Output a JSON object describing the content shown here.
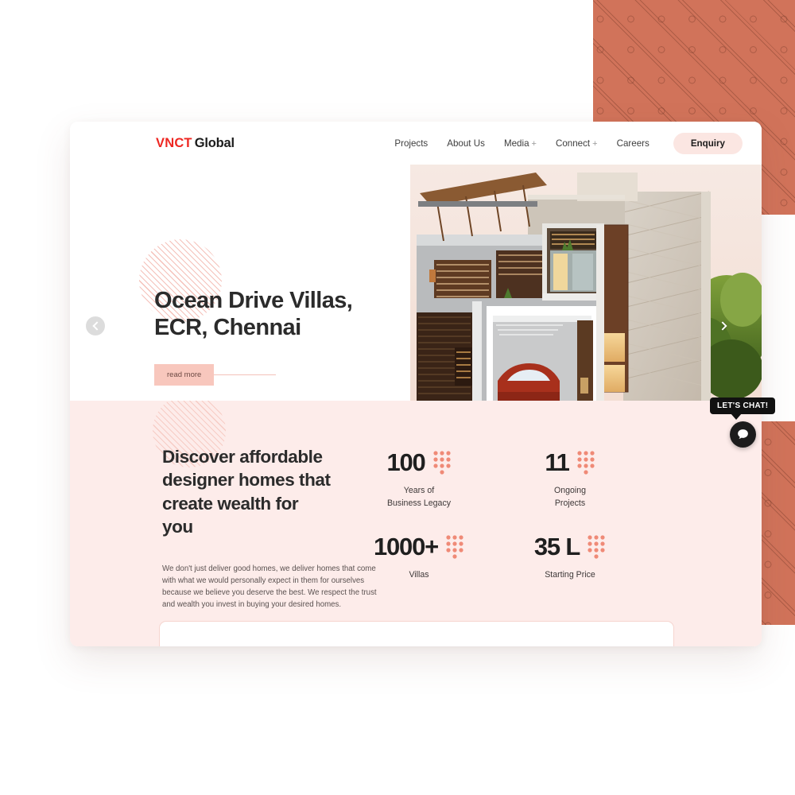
{
  "site": {
    "logo": {
      "brand_mark": "VNCT",
      "brand_name": "Global",
      "accent_color": "#ee2722"
    }
  },
  "nav": {
    "items": [
      {
        "label": "Projects",
        "has_submenu": false
      },
      {
        "label": "About Us",
        "has_submenu": false
      },
      {
        "label": "Media",
        "has_submenu": true,
        "submenu_marker": "+"
      },
      {
        "label": "Connect",
        "has_submenu": true,
        "submenu_marker": "+"
      },
      {
        "label": "Careers",
        "has_submenu": false
      }
    ],
    "cta": {
      "label": "Enquiry",
      "bg_color": "#fbe6e2"
    }
  },
  "hero": {
    "title": "Ocean Drive Villas,\nECR, Chennai",
    "read_more_label": "read more",
    "prev_label": "Previous slide",
    "next_label": "Next slide",
    "image_alt": "Modern two-storey villa exterior with carport and car"
  },
  "stats_section": {
    "heading": "Discover affordable\ndesigner homes that\ncreate wealth for you",
    "paragraph": "We don't just deliver good homes, we deliver homes that come with what we would personally expect in them for ourselves because we believe you deserve the best. We respect the trust and wealth you invest in buying your desired homes.",
    "stats": [
      {
        "value": "100",
        "label": "Years of\nBusiness Legacy"
      },
      {
        "value": "11",
        "label": "Ongoing\nProjects"
      },
      {
        "value": "1000+",
        "label": "Villas"
      },
      {
        "value": "35 L",
        "label": "Starting Price"
      }
    ],
    "bg_color": "#fdecea",
    "dot_color": "#ef8a77"
  },
  "chat": {
    "tooltip": "LET'S CHAT!",
    "button_label": "Open chat"
  },
  "decor": {
    "terracotta_color": "#d1735a",
    "hatch_color": "#f3b6ad"
  }
}
